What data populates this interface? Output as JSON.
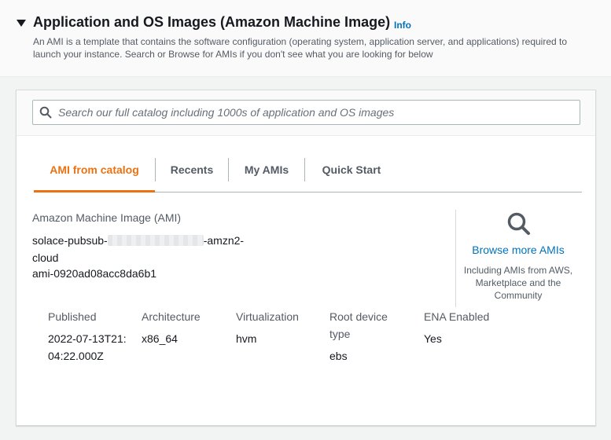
{
  "section": {
    "title": "Application and OS Images (Amazon Machine Image)",
    "info_label": "Info",
    "description": "An AMI is a template that contains the software configuration (operating system, application server, and applications) required to launch your instance. Search or Browse for AMIs if you don't see what you are looking for below"
  },
  "search": {
    "placeholder": "Search our full catalog including 1000s of application and OS images",
    "value": ""
  },
  "tabs": [
    {
      "label": "AMI from catalog",
      "active": true
    },
    {
      "label": "Recents",
      "active": false
    },
    {
      "label": "My AMIs",
      "active": false
    },
    {
      "label": "Quick Start",
      "active": false
    }
  ],
  "ami": {
    "heading": "Amazon Machine Image (AMI)",
    "name_prefix": "solace-pubsub-",
    "name_suffix": "-amzn2-",
    "name_line2": "cloud",
    "id": "ami-0920ad08acc8da6b1"
  },
  "browse": {
    "link": "Browse more AMIs",
    "subtext": "Including AMIs from AWS, Marketplace and the Community"
  },
  "properties": [
    {
      "label": "Published",
      "value": "2022-07-13T21:04:22.000Z"
    },
    {
      "label": "Architecture",
      "value": "x86_64"
    },
    {
      "label": "Virtualization",
      "value": "hvm"
    },
    {
      "label": "Root device type",
      "value": "ebs"
    },
    {
      "label": "ENA Enabled",
      "value": "Yes"
    }
  ],
  "colors": {
    "accent_orange": "#ec7211",
    "link_blue": "#0073bb",
    "text_dark": "#16191f",
    "text_secondary": "#545b64"
  }
}
